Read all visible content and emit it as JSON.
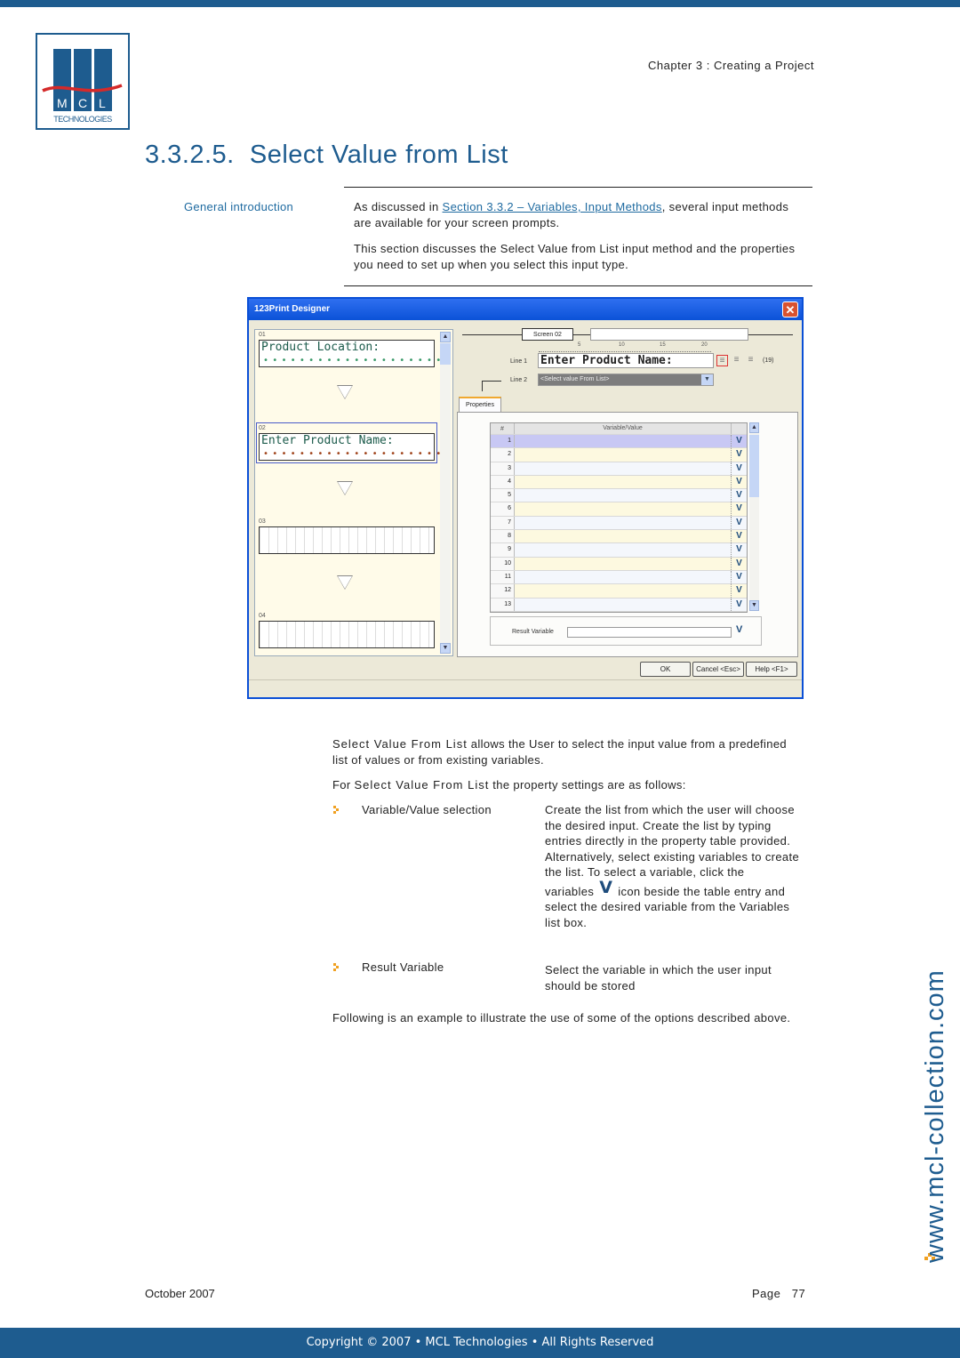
{
  "header": {
    "logo_text": "MCL",
    "logo_subtitle": "TECHNOLOGIES",
    "chapter": "Chapter 3 : Creating a Project"
  },
  "section": {
    "title": "3.3.2.5.  Select Value from List",
    "side_label": "General introduction",
    "intro_prefix": "As discussed in ",
    "intro_link": "Section 3.3.2 – Variables, Input Methods",
    "intro_suffix": ", several input methods are available for your screen prompts.",
    "intro_para2": "This section discusses the Select Value from List input method and the properties you need to set up when you select this input type."
  },
  "app_window": {
    "title": "123Print Designer",
    "close_glyph": "✕",
    "screens": [
      {
        "number": "01",
        "text": "Product Location:",
        "dots": "••••••••••••••••••••"
      },
      {
        "number": "02",
        "text": "Enter Product Name:",
        "dots": "••••••••••••••••••••"
      },
      {
        "number": "03",
        "text": ""
      },
      {
        "number": "04",
        "text": ""
      }
    ],
    "screen_tag": "Screen 02",
    "ruler_ticks": [
      "5",
      "10",
      "15",
      "20"
    ],
    "line1_label": "Line 1",
    "line1_value": "Enter Product Name:",
    "char_count": "(19)",
    "line2_label": "Line 2",
    "line2_value": "<Select value From List>",
    "tab_label": "Properties",
    "grid_header_num": "#",
    "grid_header_value": "Variable/Value",
    "grid_rows": [
      "1",
      "2",
      "3",
      "4",
      "5",
      "6",
      "7",
      "8",
      "9",
      "10",
      "11",
      "12",
      "13"
    ],
    "var_glyph": "V",
    "result_label": "Result Variable",
    "result_value": "",
    "buttons": {
      "ok": "OK",
      "cancel": "Cancel <Esc>",
      "help": "Help <F1>"
    }
  },
  "body": {
    "para1_term": "Select Value From List",
    "para1_rest": " allows the User to select the input value from a predefined list of values or from existing variables.",
    "para2_prefix": "For ",
    "para2_term": "Select Value From List",
    "para2_rest": " the property settings are as follows:",
    "properties": [
      {
        "name": "Variable/Value selection",
        "desc_part1": "Create the list from which the user will choose the desired input. Create the list by typing entries directly in the property table provided. Alternatively, select existing variables to create the list. To select a variable, click the",
        "desc_var_word": "variables",
        "desc_part2": "icon beside the table entry and select the desired variable from the Variables list box."
      },
      {
        "name": "Result Variable",
        "desc_part1": "Select the variable in which the user input should be stored"
      }
    ],
    "para3": "Following is an example to illustrate the use of some of the options described above."
  },
  "footer": {
    "date": "October 2007",
    "page_label": "Page",
    "page_number": "77",
    "copyright": "Copyright © 2007 • MCL Technologies • All Rights Reserved",
    "watermark": "www.mcl-collection.com"
  },
  "colors": {
    "brand_blue": "#1e5c8f",
    "accent_orange": "#f0a020",
    "link_blue": "#1e6aa0"
  }
}
